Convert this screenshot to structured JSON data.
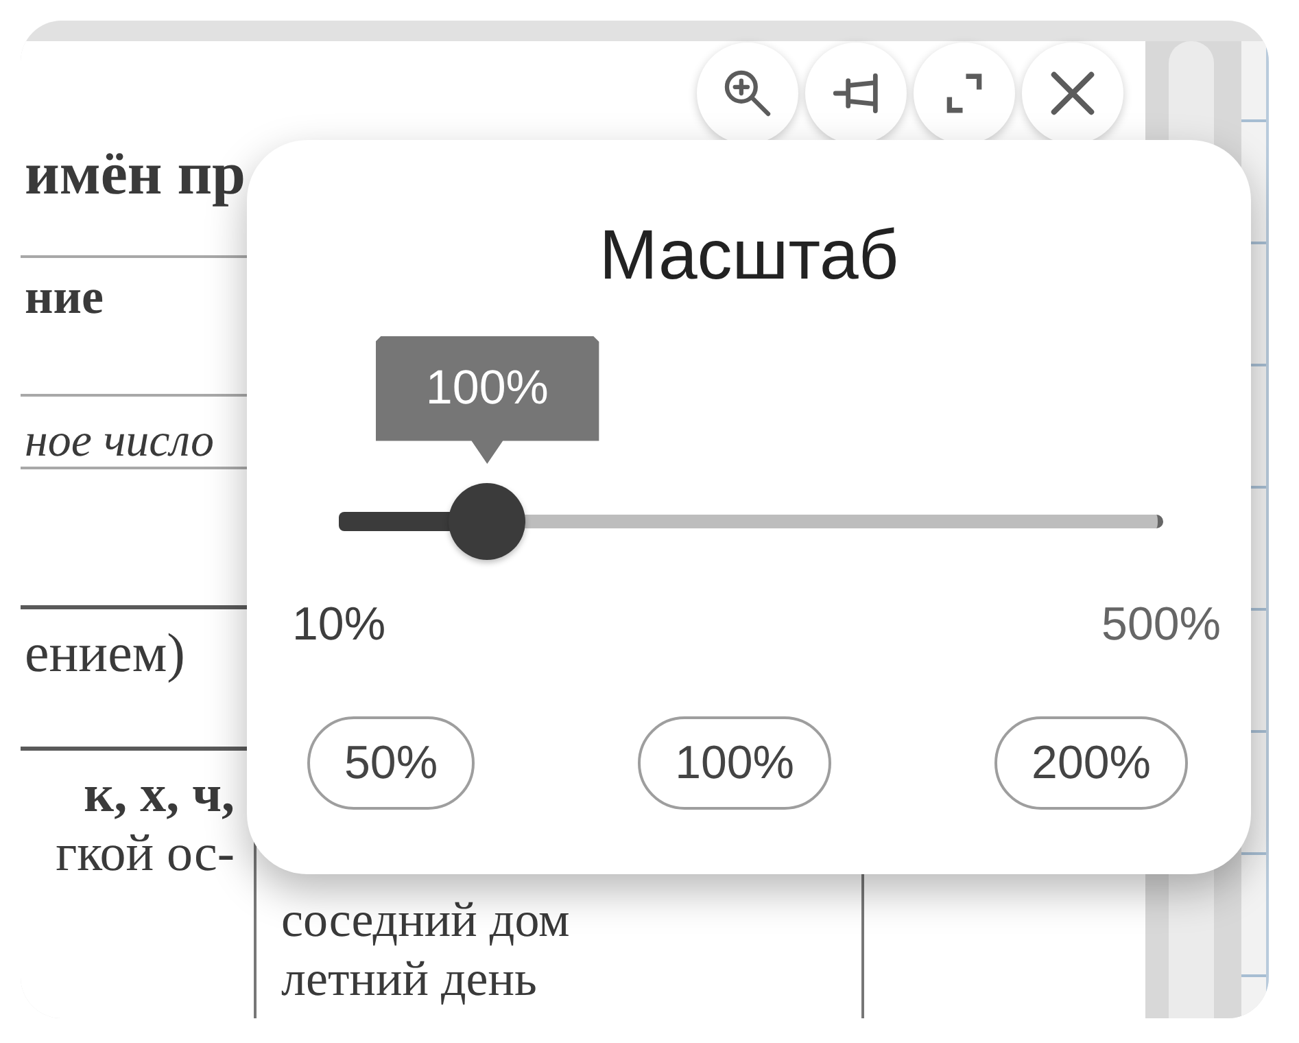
{
  "document": {
    "heading": "имён пр",
    "column_header": "ние",
    "example_text": "ное число",
    "note_text": "ением)",
    "table_row": {
      "column_1": [
        "**к, х, ч,**",
        "гкой ос-"
      ],
      "column_2": [
        "соседний дом",
        "летний день"
      ]
    }
  },
  "zoom_dialog": {
    "title": "Масштаб",
    "slider": {
      "tooltip": "100%",
      "level": 0.18,
      "min_label": "10%",
      "max_label": "500%"
    },
    "presets": [
      "50%",
      "100%",
      "200%"
    ]
  }
}
